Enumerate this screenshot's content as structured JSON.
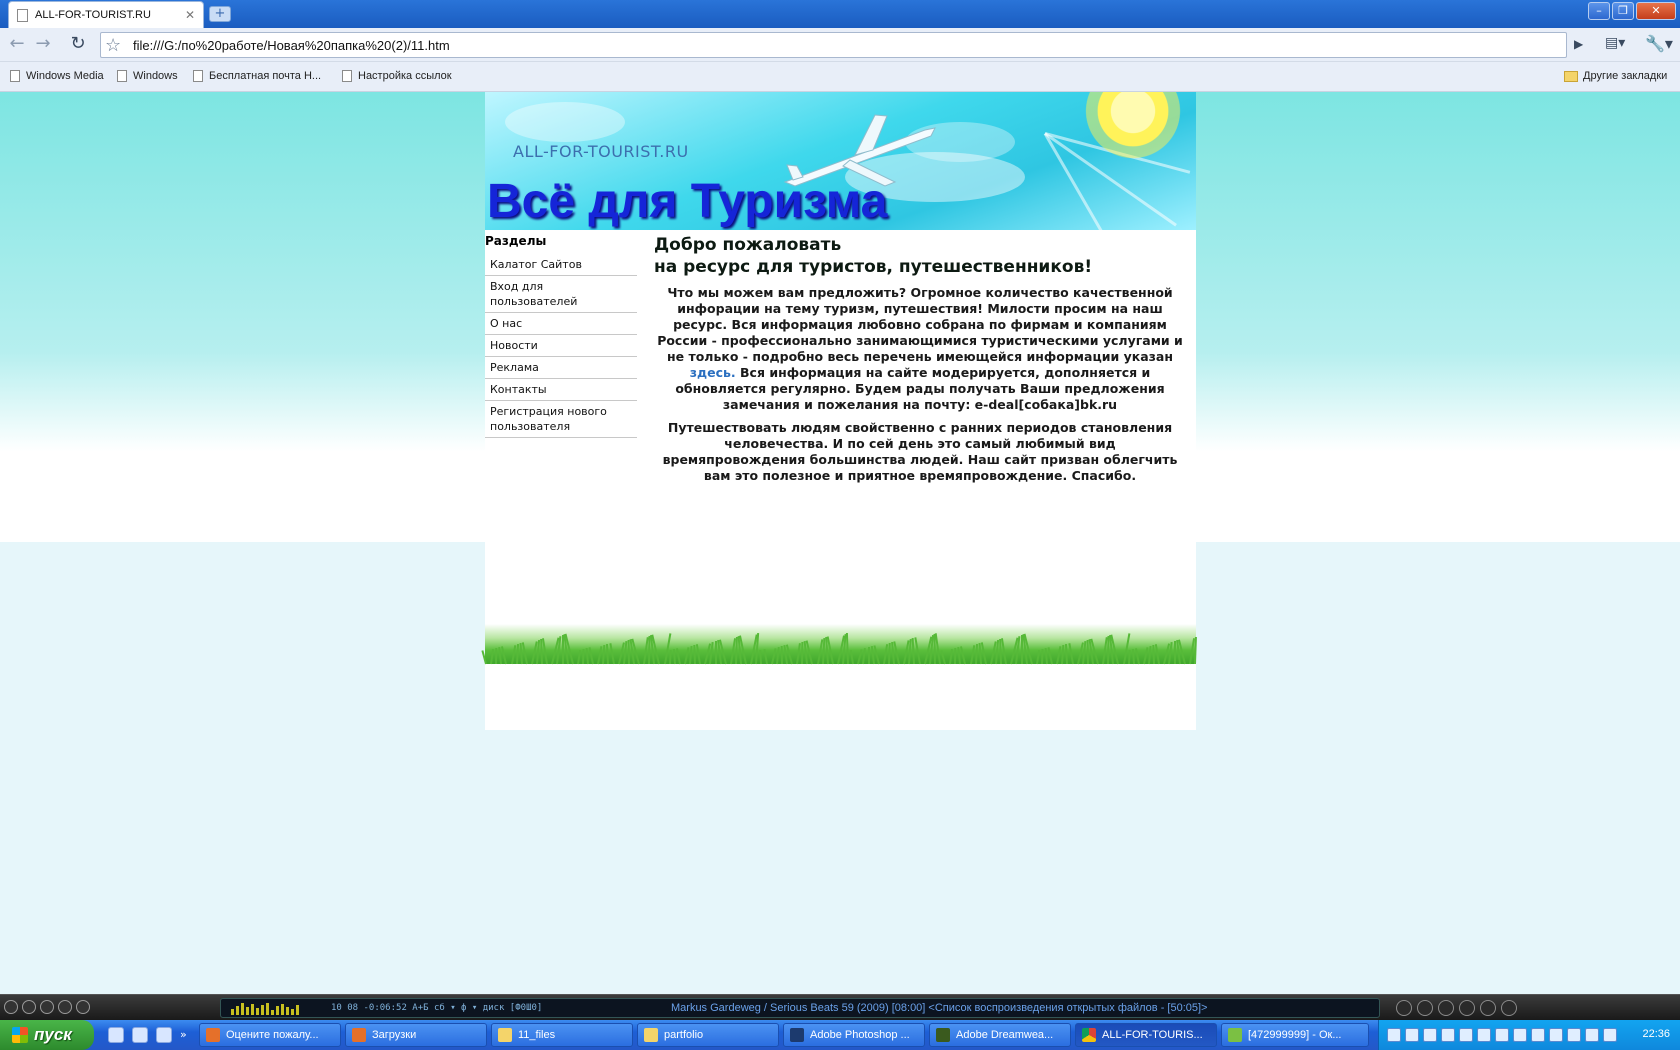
{
  "browser": {
    "tab_title": "ALL-FOR-TOURIST.RU",
    "address": "file:///G:/по%20работе/Новая%20папка%20(2)/11.htm",
    "bookmarks": [
      "Windows Media",
      "Windows",
      "Бесплатная почта Н...",
      "Настройка ссылок"
    ],
    "other_bookmarks": "Другие закладки"
  },
  "site": {
    "banner_domain": "ALL-FOR-TOURIST.RU",
    "banner_title": "Всё для Туризма",
    "sidebar_title": "Разделы",
    "menu": [
      "Калатог Сайтов",
      "Вход для пользователей",
      "О нас",
      "Новости",
      "Реклама",
      "Контакты",
      "Регистрация нового пользователя"
    ],
    "welcome_line1": "Добро пожаловать",
    "welcome_line2": "на ресурс для туристов, путешественников!",
    "para1_before_link": "Что мы можем вам предложить? Огромное количество качественной инфорации на тему туризм, путешествия! Милости просим на наш ресурс. Вся информация любовно собрана по фирмам и компаниям России - профессионально занимающимися туристическими услугами и не только - подробно весь перечень имеющейся информации указан ",
    "para1_link": "здесь.",
    "para1_after_link": " Вся информация на сайте модерируется, дополняется и обновляется регулярно. Будем рады получать Ваши предложения замечания и пожелания на почту: e-deal[собака]bk.ru",
    "para2": "Путешествовать людям свойственно с ранних периодов становления человечества. И по сей день это самый любимый вид времяпровождения большинства людей. Наш сайт призван облегчить вам это полезное и приятное времяпровождение. Спасибо."
  },
  "player": {
    "time_readout": "10   08   -0:06:52   А+Б  сб ▾  ф ▾  диск  [Ф0Ш0]",
    "track": "Markus Gardeweg / Serious Beats 59 (2009)  [08:00]    <Список воспроизведения открытых файлов - [50:05]>"
  },
  "taskbar": {
    "start_label": "пуск",
    "tasks": [
      "Оцените пожалу...",
      "Загрузки",
      "11_files",
      "partfolio",
      "Adobe Photoshop ...",
      "Adobe Dreamwea...",
      "ALL-FOR-TOURIS...",
      "[472999999] - Ок..."
    ],
    "clock": "22:36"
  },
  "colors": {
    "banner_title": "#1525d8",
    "link": "#2a6fc0",
    "taskbar": "#2458c8",
    "grass": "#5bbf3c"
  }
}
